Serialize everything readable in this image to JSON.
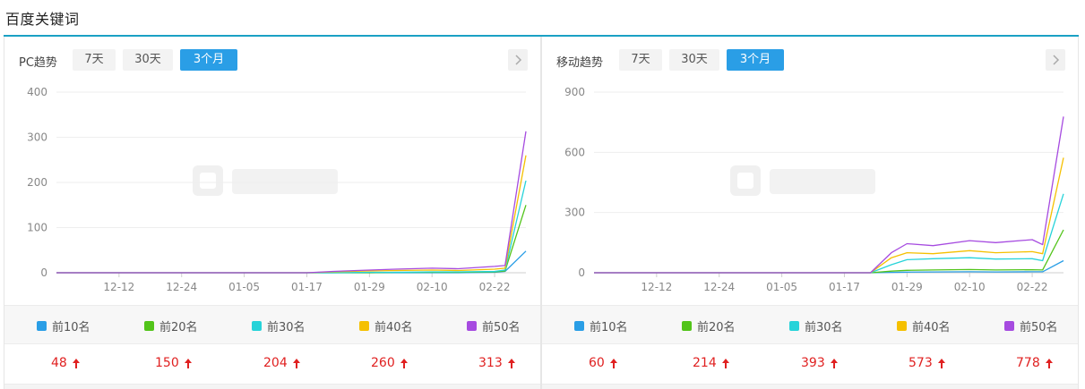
{
  "section_title": "百度关键词",
  "colors": {
    "top10": "#2a9ee6",
    "top20": "#52c41a",
    "top30": "#26d3d9",
    "top40": "#f5c000",
    "top50": "#a64be0"
  },
  "legend_labels": [
    "前10名",
    "前20名",
    "前30名",
    "前40名",
    "前50名"
  ],
  "panels": [
    {
      "label": "PC趋势",
      "range_buttons": [
        "7天",
        "30天",
        "3个月"
      ],
      "active_range": "3个月",
      "totals": [
        "48",
        "150",
        "204",
        "260",
        "313"
      ]
    },
    {
      "label": "移动趋势",
      "range_buttons": [
        "7天",
        "30天",
        "3个月"
      ],
      "active_range": "3个月",
      "totals": [
        "60",
        "214",
        "393",
        "573",
        "778"
      ]
    }
  ],
  "chart_data": [
    {
      "type": "line",
      "title": "PC趋势",
      "x_ticks": [
        "12-12",
        "12-24",
        "01-05",
        "01-17",
        "01-29",
        "02-10",
        "02-22"
      ],
      "x": [
        "11-30",
        "12-12",
        "12-24",
        "01-05",
        "01-17",
        "01-22",
        "01-29",
        "02-03",
        "02-10",
        "02-15",
        "02-22",
        "02-24",
        "02-28"
      ],
      "ylim": [
        0,
        400
      ],
      "yticks": [
        0,
        100,
        200,
        300,
        400
      ],
      "grid": true,
      "series": [
        {
          "name": "前10名",
          "values": [
            0,
            0,
            0,
            0,
            0,
            0,
            0,
            0,
            0,
            0,
            1,
            3,
            48
          ]
        },
        {
          "name": "前20名",
          "values": [
            0,
            0,
            0,
            0,
            0,
            0,
            0,
            1,
            1,
            1,
            2,
            4,
            150
          ]
        },
        {
          "name": "前30名",
          "values": [
            0,
            0,
            0,
            0,
            0,
            0,
            1,
            1,
            2,
            2,
            3,
            6,
            204
          ]
        },
        {
          "name": "前40名",
          "values": [
            0,
            0,
            0,
            0,
            0,
            2,
            4,
            5,
            6,
            5,
            8,
            10,
            260
          ]
        },
        {
          "name": "前50名",
          "values": [
            0,
            0,
            0,
            0,
            0,
            3,
            6,
            8,
            10,
            9,
            14,
            16,
            313
          ]
        }
      ]
    },
    {
      "type": "line",
      "title": "移动趋势",
      "x_ticks": [
        "12-12",
        "12-24",
        "01-05",
        "01-17",
        "01-29",
        "02-10",
        "02-22"
      ],
      "x": [
        "11-30",
        "12-12",
        "12-24",
        "01-05",
        "01-17",
        "01-22",
        "01-26",
        "01-29",
        "02-03",
        "02-10",
        "02-15",
        "02-22",
        "02-24",
        "02-28"
      ],
      "ylim": [
        0,
        900
      ],
      "yticks": [
        0,
        300,
        600,
        900
      ],
      "grid": true,
      "series": [
        {
          "name": "前10名",
          "values": [
            0,
            0,
            0,
            0,
            0,
            0,
            2,
            3,
            4,
            5,
            4,
            5,
            5,
            60
          ]
        },
        {
          "name": "前20名",
          "values": [
            0,
            0,
            0,
            0,
            0,
            0,
            8,
            12,
            14,
            16,
            14,
            15,
            14,
            214
          ]
        },
        {
          "name": "前30名",
          "values": [
            0,
            0,
            0,
            0,
            0,
            0,
            40,
            65,
            70,
            75,
            68,
            70,
            60,
            393
          ]
        },
        {
          "name": "前40名",
          "values": [
            0,
            0,
            0,
            0,
            0,
            0,
            75,
            100,
            95,
            110,
            100,
            105,
            95,
            573
          ]
        },
        {
          "name": "前50名",
          "values": [
            0,
            0,
            0,
            0,
            0,
            0,
            100,
            145,
            135,
            160,
            150,
            165,
            140,
            778
          ]
        }
      ]
    }
  ]
}
